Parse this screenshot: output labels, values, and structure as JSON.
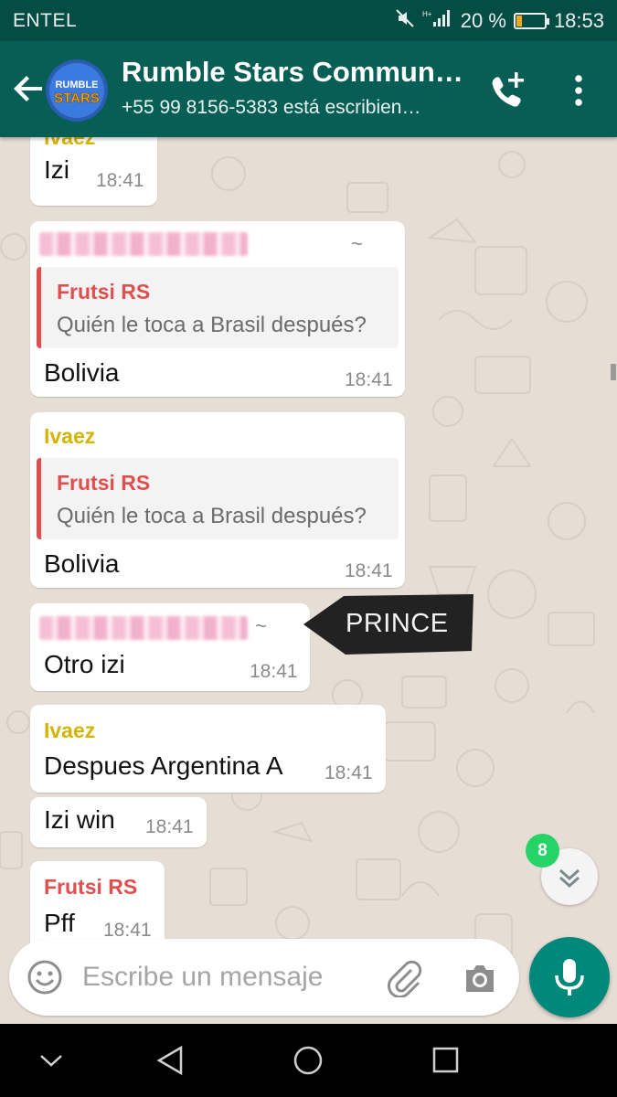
{
  "status_bar": {
    "carrier": "ENTEL",
    "battery_text": "20 %",
    "battery_level": 0.2,
    "time": "18:53"
  },
  "header": {
    "title": "Rumble Stars Commun…",
    "subtitle": "+55 99 8156-5383 está escribien…",
    "avatar_text_1": "RUMBLE",
    "avatar_text_2": "STARS"
  },
  "messages": [
    {
      "sender": "Ivaez",
      "text": "Izi",
      "time": "18:41"
    },
    {
      "sender_hidden": true,
      "tilde": "~",
      "quote": {
        "name": "Frutsi RS",
        "text": "Quién le toca a Brasil después?"
      },
      "text": "Bolivia",
      "time": "18:41"
    },
    {
      "sender": "Ivaez",
      "quote": {
        "name": "Frutsi RS",
        "text": "Quién le toca a Brasil después?"
      },
      "text": "Bolivia",
      "time": "18:41"
    },
    {
      "sender_hidden": true,
      "tilde": "~",
      "text": "Otro izi",
      "time": "18:41"
    },
    {
      "sender": "Ivaez",
      "text": "Despues Argentina A",
      "time": "18:41"
    },
    {
      "text": "Izi win",
      "time": "18:41"
    },
    {
      "sender": "Frutsi RS",
      "text": "Pff",
      "time": "18:41"
    }
  ],
  "annotation": {
    "label": "PRINCE"
  },
  "unread_count": "8",
  "composer": {
    "placeholder": "Escribe un mensaje"
  },
  "colors": {
    "header": "#075e54",
    "status_bar": "#054d44",
    "chat_bg": "#e6ddd4",
    "sender_yellow": "#d4b400",
    "sender_red": "#e04e4e",
    "mic_button": "#00897b",
    "badge": "#25d366"
  },
  "icons": [
    "back-arrow-icon",
    "add-call-icon",
    "more-vert-icon",
    "emoji-icon",
    "attach-icon",
    "camera-icon",
    "mic-icon",
    "chevron-double-down-icon",
    "nav-back-icon",
    "nav-home-icon",
    "nav-recents-icon",
    "nav-collapse-icon"
  ]
}
